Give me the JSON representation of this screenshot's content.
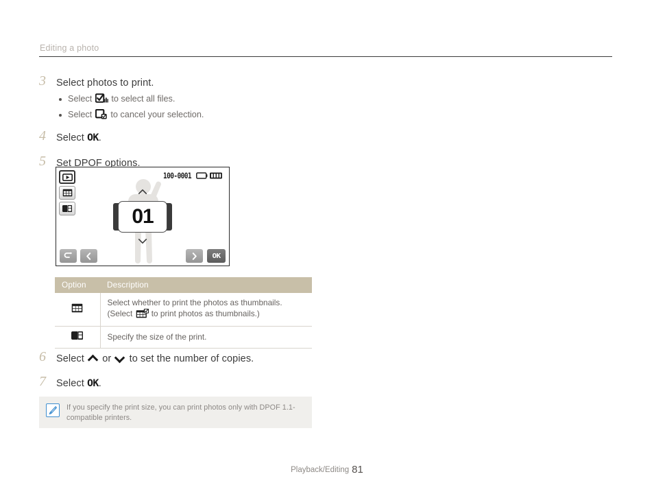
{
  "header": {
    "title": "Editing a photo"
  },
  "steps": [
    {
      "num": "3",
      "text": "Select photos to print.",
      "bullets": [
        {
          "pre": "Select",
          "icon": "select-all-checkbox-icon",
          "post": "to select all files."
        },
        {
          "pre": "Select",
          "icon": "cancel-selection-checkbox-icon",
          "post": "to cancel your selection."
        }
      ]
    },
    {
      "num": "4",
      "text_pre": "Select",
      "ok_label": "OK",
      "text_post": "."
    },
    {
      "num": "5",
      "text": "Set DPOF options."
    },
    {
      "num": "6",
      "text_pre": "Select",
      "mid": "or",
      "text_post": "to set the number of copies."
    },
    {
      "num": "7",
      "text_pre": "Select",
      "ok_label": "OK",
      "text_post": "."
    }
  ],
  "camera_screen": {
    "file_number": "100-0001",
    "copies_value": "01",
    "side_buttons": [
      {
        "name": "playback-mode-button",
        "selected": true
      },
      {
        "name": "thumbnail-print-button",
        "selected": false
      },
      {
        "name": "print-size-button",
        "selected": false
      }
    ],
    "bottom_buttons": [
      {
        "name": "back-button",
        "label": ""
      },
      {
        "name": "previous-button",
        "label": ""
      },
      {
        "name": "next-button",
        "label": ""
      },
      {
        "name": "ok-button",
        "label": "OK"
      }
    ],
    "battery_status": "full"
  },
  "table": {
    "headers": [
      "Option",
      "Description"
    ],
    "rows": [
      {
        "option_icon": "thumbnail-grid-icon",
        "desc_line1": "Select whether to print the photos as thumbnails.",
        "desc_line2_pre": "(Select",
        "desc_line2_icon": "thumbnail-grid-check-icon",
        "desc_line2_post": "to print photos as thumbnails.)"
      },
      {
        "option_icon": "print-size-icon",
        "desc_line1": "Specify the size of the print.",
        "desc_line2_pre": "",
        "desc_line2_icon": "",
        "desc_line2_post": ""
      }
    ]
  },
  "note": {
    "icon": "note-pen-icon",
    "text": "If you specify the print size, you can print photos only with DPOF 1.1-compatible printers."
  },
  "footer": {
    "section": "Playback/Editing",
    "page": "81"
  },
  "colors": {
    "table_header_bg": "#c8bfa8",
    "step_number": "#c7bda8",
    "note_bg": "#f0efec",
    "note_icon_border": "#3f8fd0",
    "header_title": "#b9b3ad"
  }
}
